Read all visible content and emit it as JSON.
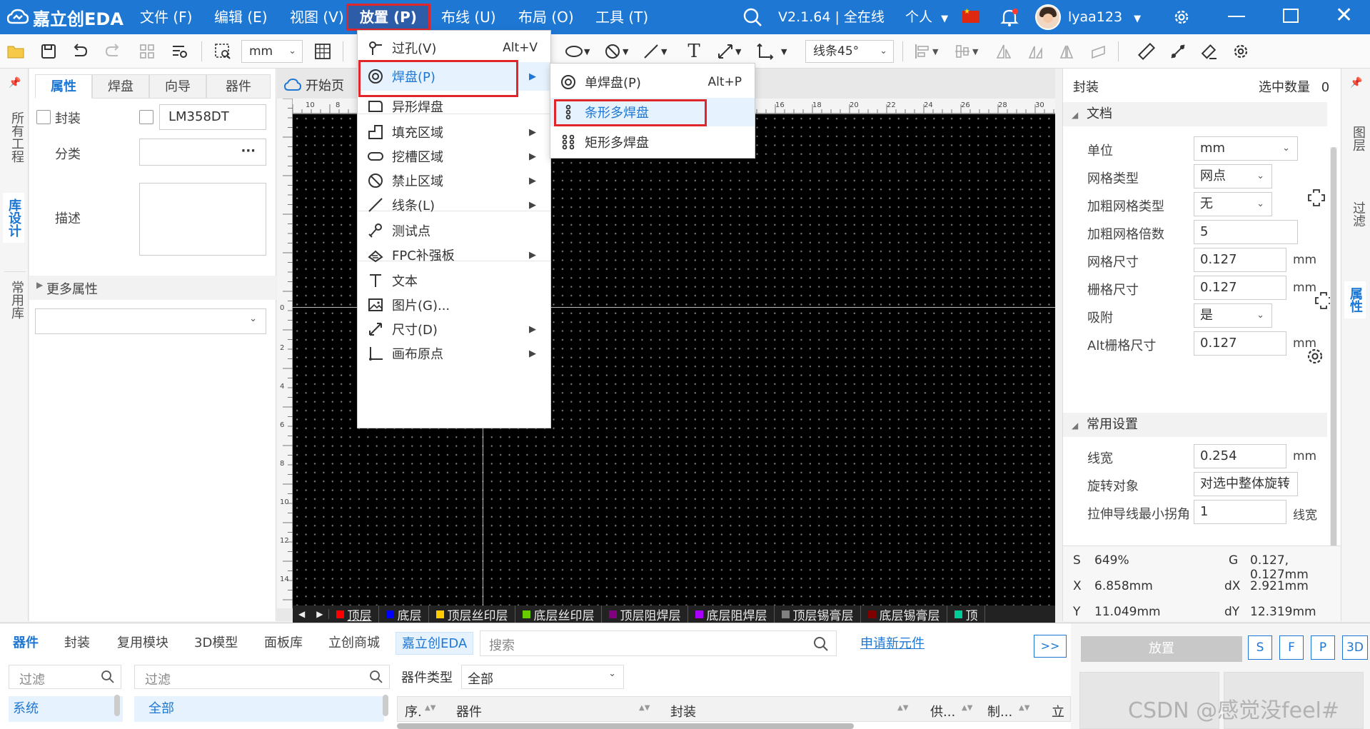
{
  "title_bar": {
    "app_name": "嘉立创EDA",
    "menus": [
      "文件 (F)",
      "编辑 (E)",
      "视图 (V)",
      "放置 (P)",
      "布线 (U)",
      "布局 (O)",
      "工具 (T)"
    ],
    "active_menu": "放置 (P)",
    "version": "V2.1.64 | 全在线",
    "mode": "个人",
    "username": "lyaa123"
  },
  "toolbar": {
    "unit_value": "mm",
    "line_mode": "线条45°"
  },
  "left_vtabs": [
    "所有工程",
    "库设计",
    "常用库"
  ],
  "left_panel": {
    "tabs": [
      "属性",
      "焊盘",
      "向导",
      "器件"
    ],
    "footprint_label": "封装",
    "footprint_value": "LM358DT",
    "category_label": "分类",
    "category_dots": "···",
    "desc_label": "描述",
    "more_props": "更多属性"
  },
  "doc_tab": "开始页",
  "place_menu": {
    "items": [
      {
        "label": "过孔(V)",
        "shortcut": "Alt+V",
        "arrow": false,
        "icon": "via-icon"
      },
      {
        "label": "焊盘(P)",
        "shortcut": "",
        "arrow": true,
        "icon": "pad-icon"
      },
      {
        "label": "异形焊盘",
        "shortcut": "",
        "arrow": false,
        "icon": "custom-pad-icon"
      },
      {
        "label": "填充区域",
        "shortcut": "",
        "arrow": true,
        "icon": "fill-region-icon"
      },
      {
        "label": "挖槽区域",
        "shortcut": "",
        "arrow": true,
        "icon": "slot-region-icon"
      },
      {
        "label": "禁止区域",
        "shortcut": "",
        "arrow": true,
        "icon": "forbidden-region-icon"
      },
      {
        "label": "线条(L)",
        "shortcut": "",
        "arrow": true,
        "icon": "line-icon"
      },
      {
        "label": "测试点",
        "shortcut": "",
        "arrow": false,
        "icon": "test-point-icon"
      },
      {
        "label": "FPC补强板",
        "shortcut": "",
        "arrow": true,
        "icon": "fpc-stiffener-icon"
      },
      {
        "label": "文本",
        "shortcut": "",
        "arrow": false,
        "icon": "text-icon"
      },
      {
        "label": "图片(G)...",
        "shortcut": "",
        "arrow": false,
        "icon": "image-icon"
      },
      {
        "label": "尺寸(D)",
        "shortcut": "",
        "arrow": true,
        "icon": "dimension-icon"
      },
      {
        "label": "画布原点",
        "shortcut": "",
        "arrow": true,
        "icon": "canvas-origin-icon"
      }
    ]
  },
  "pad_submenu": {
    "items": [
      {
        "label": "单焊盘(P)",
        "shortcut": "Alt+P"
      },
      {
        "label": "条形多焊盘",
        "shortcut": ""
      },
      {
        "label": "矩形多焊盘",
        "shortcut": ""
      }
    ]
  },
  "ruler": {
    "top_ticks": [
      "10",
      "8",
      "16",
      "18",
      "20",
      "22",
      "24",
      "26",
      "28",
      "30"
    ],
    "left_ticks": [
      "0",
      "2",
      "4",
      "6",
      "8",
      "10",
      "12",
      "14",
      "16"
    ]
  },
  "layers": [
    {
      "name": "顶层",
      "color": "#ff0000"
    },
    {
      "name": "底层",
      "color": "#0000ff"
    },
    {
      "name": "顶层丝印层",
      "color": "#ffcc00"
    },
    {
      "name": "底层丝印层",
      "color": "#66cc00"
    },
    {
      "name": "顶层阻焊层",
      "color": "#800080"
    },
    {
      "name": "底层阻焊层",
      "color": "#aa00ff"
    },
    {
      "name": "顶层锡膏层",
      "color": "#808080"
    },
    {
      "name": "底层锡膏层",
      "color": "#800000"
    },
    {
      "name": "顶",
      "color": "#00cc99"
    }
  ],
  "right_panel": {
    "header_label": "封装",
    "selection_label": "选中数量",
    "selection_count": "0",
    "doc_section": "文档",
    "rows": [
      {
        "label": "单位",
        "value": "mm",
        "type": "select",
        "unit": ""
      },
      {
        "label": "网格类型",
        "value": "网点",
        "type": "select",
        "unit": ""
      },
      {
        "label": "加粗网格类型",
        "value": "无",
        "type": "select",
        "unit": ""
      },
      {
        "label": "加粗网格倍数",
        "value": "5",
        "type": "input",
        "unit": ""
      },
      {
        "label": "网格尺寸",
        "value": "0.127",
        "type": "input",
        "unit": "mm"
      },
      {
        "label": "栅格尺寸",
        "value": "0.127",
        "type": "input",
        "unit": "mm"
      },
      {
        "label": "吸附",
        "value": "是",
        "type": "select",
        "unit": ""
      },
      {
        "label": "Alt栅格尺寸",
        "value": "0.127",
        "type": "input",
        "unit": "mm"
      }
    ],
    "common_section": "常用设置",
    "common_rows": [
      {
        "label": "线宽",
        "value": "0.254",
        "type": "input",
        "unit": "mm"
      },
      {
        "label": "旋转对象",
        "value": "对选中整体旋转",
        "type": "select",
        "unit": ""
      },
      {
        "label": "拉伸导线最小拐角",
        "value": "1",
        "type": "input",
        "unit": "线宽"
      }
    ],
    "status": {
      "s_label": "S",
      "s_value": "649%",
      "g_label": "G",
      "g_value": "0.127, 0.127mm",
      "x_label": "X",
      "x_value": "6.858mm",
      "dx_label": "dX",
      "dx_value": "2.921mm",
      "y_label": "Y",
      "y_value": "11.049mm",
      "dy_label": "dY",
      "dy_value": "12.319mm"
    }
  },
  "right_vtabs": [
    "图层",
    "过滤",
    "属性"
  ],
  "bottom": {
    "tabs": [
      "器件",
      "封装",
      "复用模块",
      "3D模型",
      "面板库",
      "立创商城",
      "嘉立创EDA"
    ],
    "search_placeholder": "搜索",
    "apply_link": "申请新元件",
    "expand": ">>",
    "filter_placeholder_1": "过滤",
    "filter_placeholder_2": "过滤",
    "system_item": "系统",
    "all_item": "全部",
    "type_label": "器件类型",
    "type_value": "全部",
    "columns": [
      "序.",
      "器件",
      "封装",
      "供...",
      "制...",
      "立"
    ],
    "place_button": "放置",
    "mode_buttons": [
      "S",
      "F",
      "P",
      "3D"
    ]
  },
  "watermark": "CSDN @感觉没feel#"
}
